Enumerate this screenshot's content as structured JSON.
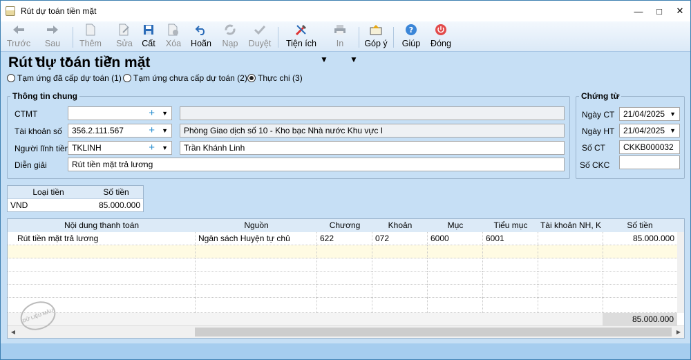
{
  "window": {
    "title": "Rút dự toán tiền mặt"
  },
  "toolbar": {
    "prev": "Trước",
    "next": "Sau",
    "add": "Thêm",
    "edit": "Sửa",
    "save": "Cất",
    "delete": "Xóa",
    "undo": "Hoãn",
    "reload": "Nạp",
    "approve": "Duyệt",
    "utilities": "Tiện ích",
    "print": "In",
    "feedback": "Góp ý",
    "help": "Giúp",
    "close": "Đóng"
  },
  "page": {
    "title": "Rút dự toán tiền mặt"
  },
  "modes": [
    {
      "label": "Tạm ứng đã cấp dự toán (1)",
      "selected": false
    },
    {
      "label": "Tạm ứng chưa cấp dự toán (2)",
      "selected": false
    },
    {
      "label": "Thực chi (3)",
      "selected": true
    }
  ],
  "general": {
    "legend": "Thông tin chung",
    "ctmt": {
      "label": "CTMT",
      "value": "",
      "desc": ""
    },
    "account": {
      "label": "Tài khoản số",
      "value": "356.2.111.567",
      "desc": "Phòng Giao dịch số 10 - Kho bạc Nhà nước Khu vực I"
    },
    "recipient": {
      "label": "Người lĩnh tiền",
      "value": "TKLINH",
      "desc": "Trần Khánh Linh"
    },
    "description": {
      "label": "Diễn giải",
      "value": "Rút tiền mặt trả lương"
    }
  },
  "voucher": {
    "legend": "Chứng từ",
    "date_ct": {
      "label": "Ngày CT",
      "value": "21/04/2025"
    },
    "date_ht": {
      "label": "Ngày HT",
      "value": "21/04/2025"
    },
    "so_ct": {
      "label": "Số CT",
      "value": "CKKB000032"
    },
    "so_ckc": {
      "label": "Số CKC",
      "value": ""
    }
  },
  "currency_table": {
    "headers": [
      "Loại tiền",
      "Số tiền"
    ],
    "rows": [
      {
        "currency": "VND",
        "amount": "85.000.000"
      }
    ]
  },
  "detail_table": {
    "headers": [
      "Nội dung thanh toán",
      "Nguồn",
      "Chương",
      "Khoản",
      "Mục",
      "Tiểu mục",
      "Tài khoản NH, K",
      "Số tiền"
    ],
    "rows": [
      {
        "content": "Rút tiền mặt trả lương",
        "source": "Ngân sách Huyện tự chủ",
        "chuong": "622",
        "khoan": "072",
        "muc": "6000",
        "tieu_muc": "6001",
        "bank_account": "",
        "amount": "85.000.000"
      }
    ],
    "total": "85.000.000"
  },
  "stamp": {
    "text": "DỮ LIỆU MẪU"
  }
}
